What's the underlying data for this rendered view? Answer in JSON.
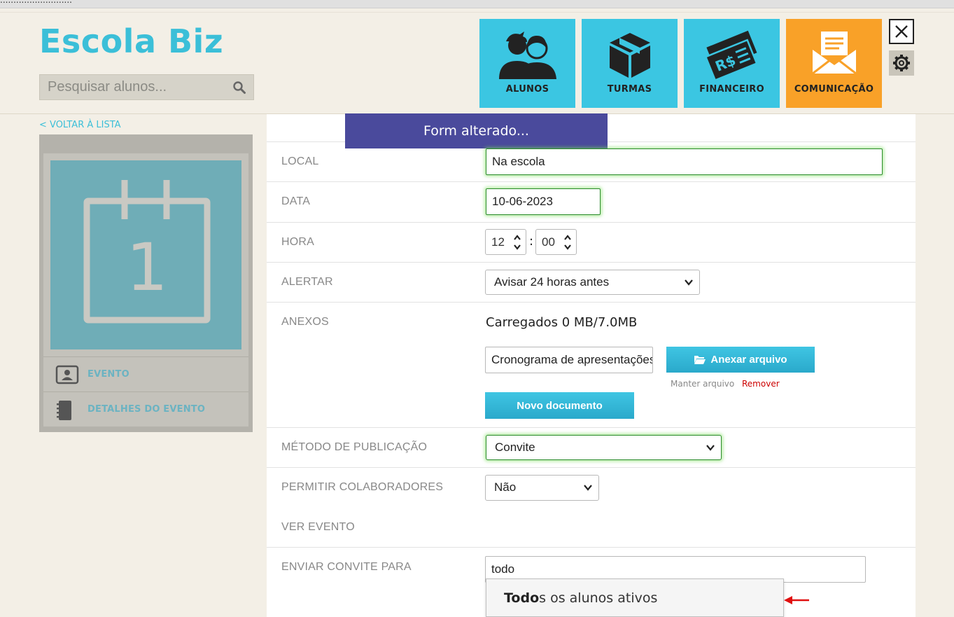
{
  "browser": {
    "url_fragment": "..........................."
  },
  "header": {
    "logo": "Escola Biz",
    "search_placeholder": "Pesquisar alunos...",
    "nav": [
      {
        "label": "ALUNOS",
        "icon": "students-icon"
      },
      {
        "label": "TURMAS",
        "icon": "box-icon"
      },
      {
        "label": "FINANCEIRO",
        "icon": "money-icon"
      },
      {
        "label": "COMUNICAÇÃO",
        "icon": "envelope-icon",
        "active": true
      }
    ]
  },
  "sidebar": {
    "back_link": "< VOLTAR À LISTA",
    "calendar_day": "1",
    "items": [
      {
        "label": "EVENTO",
        "icon": "contact-card-icon"
      },
      {
        "label": "DETALHES DO EVENTO",
        "icon": "notebook-icon"
      }
    ]
  },
  "toast": {
    "message": "Form alterado..."
  },
  "form": {
    "local": {
      "label": "LOCAL",
      "value": "Na escola"
    },
    "data": {
      "label": "DATA",
      "value": "10-06-2023"
    },
    "hora": {
      "label": "HORA",
      "hour": "12",
      "minute": "00",
      "separator": ":"
    },
    "alertar": {
      "label": "ALERTAR",
      "value": "Avisar 24 horas antes"
    },
    "anexos": {
      "label": "ANEXOS",
      "status": "Carregados 0 MB/7.0MB",
      "file_name": "Cronograma de apresentações",
      "attach_button": "Anexar arquivo",
      "keep_link": "Manter arquivo",
      "remove_link": "Remover",
      "new_doc_button": "Novo documento"
    },
    "metodo": {
      "label": "MÉTODO DE PUBLICAÇÃO",
      "value": "Convite"
    },
    "colaboradores": {
      "label": "PERMITIR COLABORADORES",
      "value": "Não"
    },
    "ver_evento": {
      "label": "VER EVENTO"
    },
    "convite": {
      "label": "ENVIAR CONVITE PARA",
      "value": "todo",
      "suggestion_match": "Todo",
      "suggestion_rest": "s os alunos ativos"
    }
  },
  "colors": {
    "brand": "#3bbfd8",
    "active_tile": "#f9a128",
    "toast": "#4a4a9c",
    "remove": "#cc0000"
  }
}
